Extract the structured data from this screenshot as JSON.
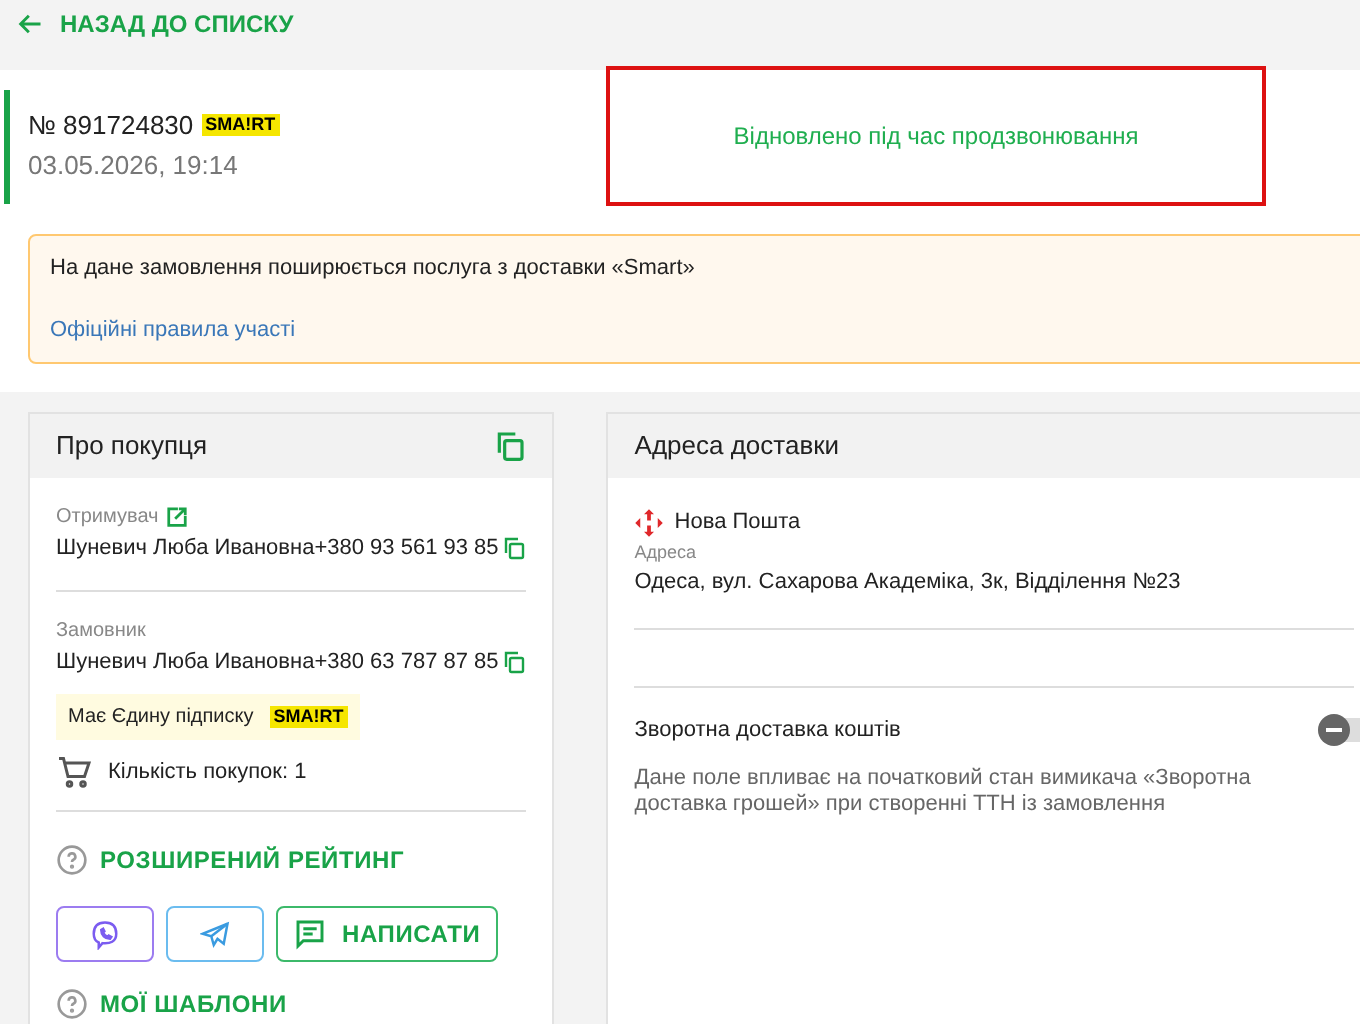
{
  "back_link": "НАЗАД ДО СПИСКУ",
  "order": {
    "number": "№ 891724830",
    "badge": "SMA!RT",
    "date": "03.05.2026, 19:14",
    "status": "Відновлено під час продзвонювання"
  },
  "notice": {
    "text": "На дане замовлення поширюється послуга з доставки «Smart»",
    "link": "Офіційні правила участі"
  },
  "buyer": {
    "title": "Про покупця",
    "contacts": [
      {
        "role": "Отримувач",
        "name": "Шуневич Люба Ивановна",
        "phone": "+380 93 561 93 85",
        "editable": true
      },
      {
        "role": "Замовник",
        "name": "Шуневич Люба Ивановна",
        "phone": "+380 63 787 87 85",
        "editable": false
      }
    ],
    "subscription": {
      "text": "Має Єдину підписку",
      "badge": "SMA!RT"
    },
    "purchases": "Кількість покупок: 1",
    "rating": "РОЗШИРЕНИЙ РЕЙТИНГ",
    "write_button": "НАПИСАТИ",
    "templates": "МОЇ ШАБЛОНИ"
  },
  "delivery": {
    "title": "Адреса доставки",
    "carrier": "Нова Пошта",
    "address_label": "Адреса",
    "address": "Одеса, вул. Сахарова Академіка, 3к, Відділення №23",
    "cod": {
      "label": "Зворотна доставка коштів",
      "on": false,
      "hint": "Дане поле впливає на початковий стан вимикача «Зворотна доставка грошей» при створенні ТТН із замовлення"
    }
  }
}
